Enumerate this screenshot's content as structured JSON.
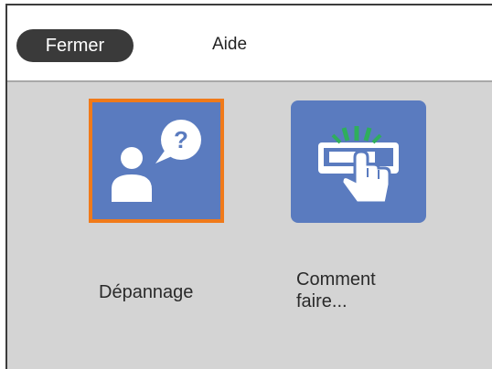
{
  "header": {
    "close_label": "Fermer",
    "title": "Aide"
  },
  "tiles": [
    {
      "label": "Dépannage",
      "icon": "person-question-icon"
    },
    {
      "label": "Comment faire...",
      "icon": "printer-touch-icon"
    }
  ],
  "colors": {
    "tile_blue": "#5a7bbf",
    "selection_orange": "#f07a1a",
    "screen_gray": "#d4d4d4",
    "button_dark": "#3a3a3a",
    "panel_green": "#2fae5c"
  }
}
